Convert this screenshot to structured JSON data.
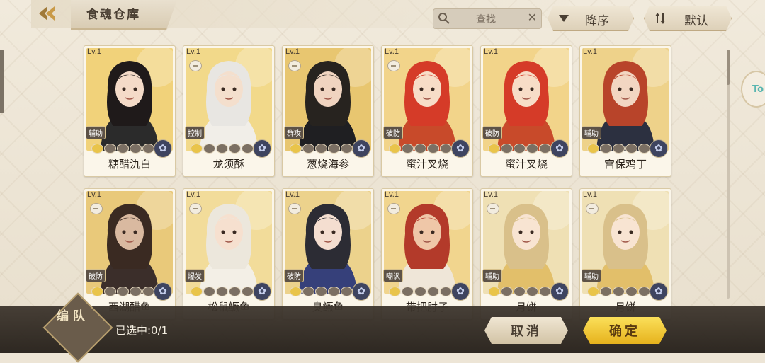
{
  "header": {
    "title": "食魂仓库",
    "search_placeholder": "查找",
    "sort_order_label": "降序",
    "sort_default_label": "默认"
  },
  "cards": [
    {
      "level": "Lv.1",
      "role": "辅助",
      "name": "糖醋氿白",
      "stars": 1,
      "bg": "#f1d27a",
      "hair": "#1f1a1a",
      "outfit": "#2b2b2b",
      "skin": "#f4dbc8"
    },
    {
      "level": "Lv.1",
      "role": "控制",
      "name": "龙须酥",
      "stars": 1,
      "bg": "#f2d98a",
      "hair": "#e8e6e2",
      "outfit": "#f1eee8",
      "skin": "#f4dfcd"
    },
    {
      "level": "Lv.1",
      "role": "群攻",
      "name": "葱烧海参",
      "stars": 1,
      "bg": "#e8c670",
      "hair": "#27231f",
      "outfit": "#1f1f22",
      "skin": "#f0d4c0"
    },
    {
      "level": "Lv.1",
      "role": "破防",
      "name": "蜜汁叉烧",
      "stars": 1,
      "bg": "#f2d48a",
      "hair": "#d53b28",
      "outfit": "#c84a2a",
      "skin": "#f7ddc7"
    },
    {
      "level": "Lv.1",
      "role": "破防",
      "name": "蜜汁叉烧",
      "stars": 1,
      "bg": "#f2d48a",
      "hair": "#d53b28",
      "outfit": "#c84a2a",
      "skin": "#f7ddc7"
    },
    {
      "level": "Lv.1",
      "role": "辅助",
      "name": "宫保鸡丁",
      "stars": 1,
      "bg": "#eed28a",
      "hair": "#b8442a",
      "outfit": "#2c3040",
      "skin": "#f2d6c2"
    },
    {
      "level": "Lv.1",
      "role": "破防",
      "name": "西湖醋鱼",
      "stars": 1,
      "bg": "#e9c97a",
      "hair": "#3a2a22",
      "outfit": "#3b2e2a",
      "skin": "#d9b9a0"
    },
    {
      "level": "Lv.1",
      "role": "爆发",
      "name": "松鼠鳜鱼",
      "stars": 1,
      "bg": "#f2dc9a",
      "hair": "#ece7dc",
      "outfit": "#f3efe6",
      "skin": "#f6e0cf"
    },
    {
      "level": "Lv.1",
      "role": "破防",
      "name": "臭鳜鱼",
      "stars": 1,
      "bg": "#ecd28c",
      "hair": "#2c2c34",
      "outfit": "#36407a",
      "skin": "#f4ded0"
    },
    {
      "level": "Lv.1",
      "role": "嘲讽",
      "name": "带把肘子",
      "stars": 1,
      "bg": "#f1d58e",
      "hair": "#b33a2a",
      "outfit": "#efe6d8",
      "skin": "#efc7a8"
    },
    {
      "level": "Lv.1",
      "role": "辅助",
      "name": "月饼",
      "stars": 1,
      "bg": "#efe0b4",
      "hair": "#d9c08a",
      "outfit": "#e2bf6a",
      "skin": "#f8e4d2"
    },
    {
      "level": "Lv.1",
      "role": "辅助",
      "name": "月饼",
      "stars": 1,
      "bg": "#efe0b4",
      "hair": "#d9c08a",
      "outfit": "#e2bf6a",
      "skin": "#f8e4d2"
    }
  ],
  "footer": {
    "team_label": "编 队",
    "selected_text": "已选中:0/1",
    "cancel_label": "取消",
    "confirm_label": "确定"
  },
  "float_button": {
    "label": "To"
  }
}
